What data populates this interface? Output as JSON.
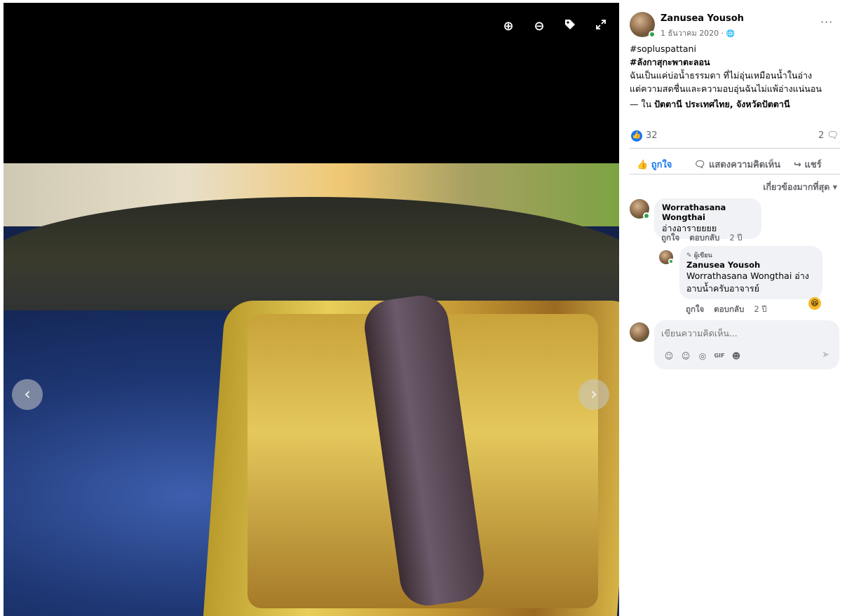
{
  "viewer": {
    "tools": [
      {
        "icon": "zoom-in-icon",
        "glyph": "⊕"
      },
      {
        "icon": "zoom-out-icon",
        "glyph": "⊖"
      },
      {
        "icon": "tag-icon",
        "glyph": "🏷"
      },
      {
        "icon": "fullscreen-icon",
        "glyph": "⤢"
      }
    ],
    "prev_glyph": "‹",
    "next_glyph": "›"
  },
  "post": {
    "author": "Zanusea Yousoh",
    "date": "1 ธันวาคม 2020 ·",
    "more": "···",
    "hashtag1": "#sopluspattani",
    "hashtag2": "#ลังกาสุกะพาตะลอน",
    "line1": "ฉันเป็นแค่บ่อน้ำธรรมดา ที่ไม่อุ่นเหมือนน้ำในอ่าง",
    "line2": "แต่ความสดชื่นและความอบอุ่นฉันไม่แพ้อ่างแน่นอน",
    "location_prefix": "— ใน ",
    "location": "ปัตตานี ประเทศไทย, จังหวัดปัตตานี",
    "like_count": "32",
    "comment_count": "2",
    "actions": {
      "like": "ถูกใจ",
      "comment": "แสดงความคิดเห็น",
      "share": "แชร์"
    },
    "sort": "เกี่ยวข้องมากที่สุด ▾"
  },
  "comments": [
    {
      "name": "Worrathasana Wongthai",
      "text": "อ่างอารายยยย",
      "like": "ถูกใจ",
      "reply": "ตอบกลับ",
      "time": "2 ปี"
    },
    {
      "tag": "ผู้เขียน",
      "name": "Zanusea Yousoh",
      "mention": "Worrathasana Wongthai",
      "text_line1_rest": " อ่าง",
      "text_line2": "อาบน้ำครับอาจารย์",
      "like": "ถูกใจ",
      "reply": "ตอบกลับ",
      "time": "2 ปี",
      "reaction": "😆"
    }
  ],
  "compose": {
    "placeholder": "เขียนความคิดเห็น...",
    "icons": [
      "sticker-icon",
      "emoji-icon",
      "camera-icon",
      "gif-icon",
      "avatar-sticker-icon"
    ],
    "send": "➤"
  },
  "colors": {
    "accent": "#1877f2",
    "online": "#31a24c",
    "muted": "#65676b"
  }
}
